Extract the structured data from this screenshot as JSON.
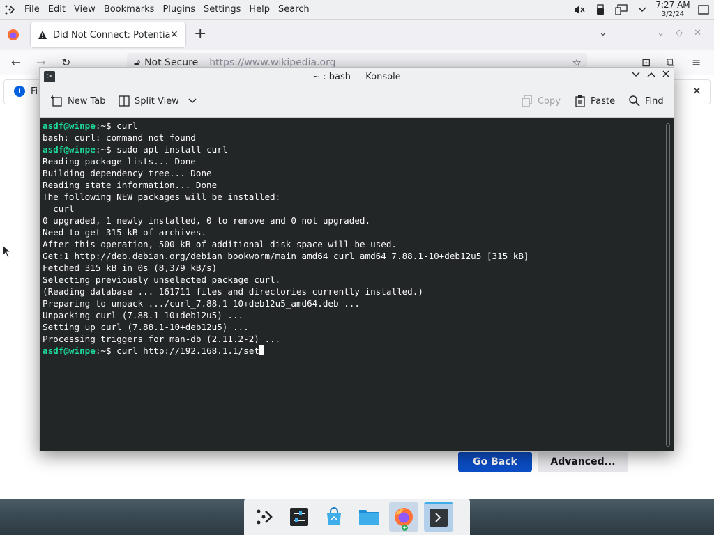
{
  "top_panel": {
    "menus": [
      "File",
      "Edit",
      "View",
      "Bookmarks",
      "Plugins",
      "Settings",
      "Help",
      "Search"
    ],
    "clock": {
      "time": "7:27 AM",
      "date": "3/2/24"
    },
    "tray_icons": [
      "muted-volume-icon",
      "usb-icon",
      "network-icon",
      "chevron-down-icon",
      "show-desktop-icon"
    ]
  },
  "firefox": {
    "tab_title": "Did Not Connect: Potential",
    "url_security": "Not Secure",
    "url": "https://www.wikipedia.org",
    "notification_text": "Fi",
    "go_back_label": "Go Back",
    "advanced_label": "Advanced..."
  },
  "konsole": {
    "title": "~ : bash — Konsole",
    "toolbar": {
      "new_tab": "New Tab",
      "split_view": "Split View",
      "copy": "Copy",
      "paste": "Paste",
      "find": "Find"
    },
    "terminal": {
      "prompt": "asdf@winpe",
      "prompt_suffix": ":~$ ",
      "lines": [
        {
          "prompt": true,
          "text": "curl"
        },
        {
          "prompt": false,
          "text": "bash: curl: command not found"
        },
        {
          "prompt": true,
          "text": "sudo apt install curl"
        },
        {
          "prompt": false,
          "text": "Reading package lists... Done"
        },
        {
          "prompt": false,
          "text": "Building dependency tree... Done"
        },
        {
          "prompt": false,
          "text": "Reading state information... Done"
        },
        {
          "prompt": false,
          "text": "The following NEW packages will be installed:"
        },
        {
          "prompt": false,
          "text": "  curl"
        },
        {
          "prompt": false,
          "text": "0 upgraded, 1 newly installed, 0 to remove and 0 not upgraded."
        },
        {
          "prompt": false,
          "text": "Need to get 315 kB of archives."
        },
        {
          "prompt": false,
          "text": "After this operation, 500 kB of additional disk space will be used."
        },
        {
          "prompt": false,
          "text": "Get:1 http://deb.debian.org/debian bookworm/main amd64 curl amd64 7.88.1-10+deb12u5 [315 kB]"
        },
        {
          "prompt": false,
          "text": "Fetched 315 kB in 0s (8,379 kB/s)"
        },
        {
          "prompt": false,
          "text": "Selecting previously unselected package curl."
        },
        {
          "prompt": false,
          "text": "(Reading database ... 161711 files and directories currently installed.)"
        },
        {
          "prompt": false,
          "text": "Preparing to unpack .../curl_7.88.1-10+deb12u5_amd64.deb ..."
        },
        {
          "prompt": false,
          "text": "Unpacking curl (7.88.1-10+deb12u5) ..."
        },
        {
          "prompt": false,
          "text": "Setting up curl (7.88.1-10+deb12u5) ..."
        },
        {
          "prompt": false,
          "text": "Processing triggers for man-db (2.11.2-2) ..."
        }
      ],
      "current_input": "curl http://192.168.1.1/set"
    }
  },
  "taskbar": {
    "items": [
      "application-launcher-icon",
      "system-settings-icon",
      "discover-store-icon",
      "dolphin-files-icon",
      "firefox-icon",
      "konsole-icon"
    ]
  }
}
